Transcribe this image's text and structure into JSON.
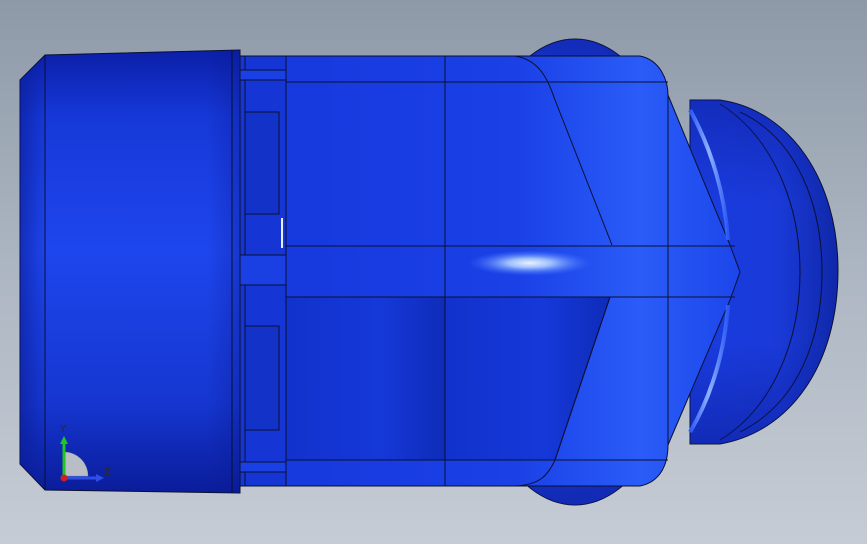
{
  "viewport": {
    "background_top": "#8e99a8",
    "background_bottom": "#c6ccd5"
  },
  "model": {
    "description_icon": "hex-lug-nut-3d-model",
    "body_color": "#1a3ae0",
    "edge_color": "#0a1030",
    "highlight_color": "#9fc0ff"
  },
  "triad": {
    "y_label": "Y",
    "z_label": "Z",
    "y_color": "#21c521",
    "z_color": "#2d4fe6",
    "x_color": "#d21d1d"
  }
}
